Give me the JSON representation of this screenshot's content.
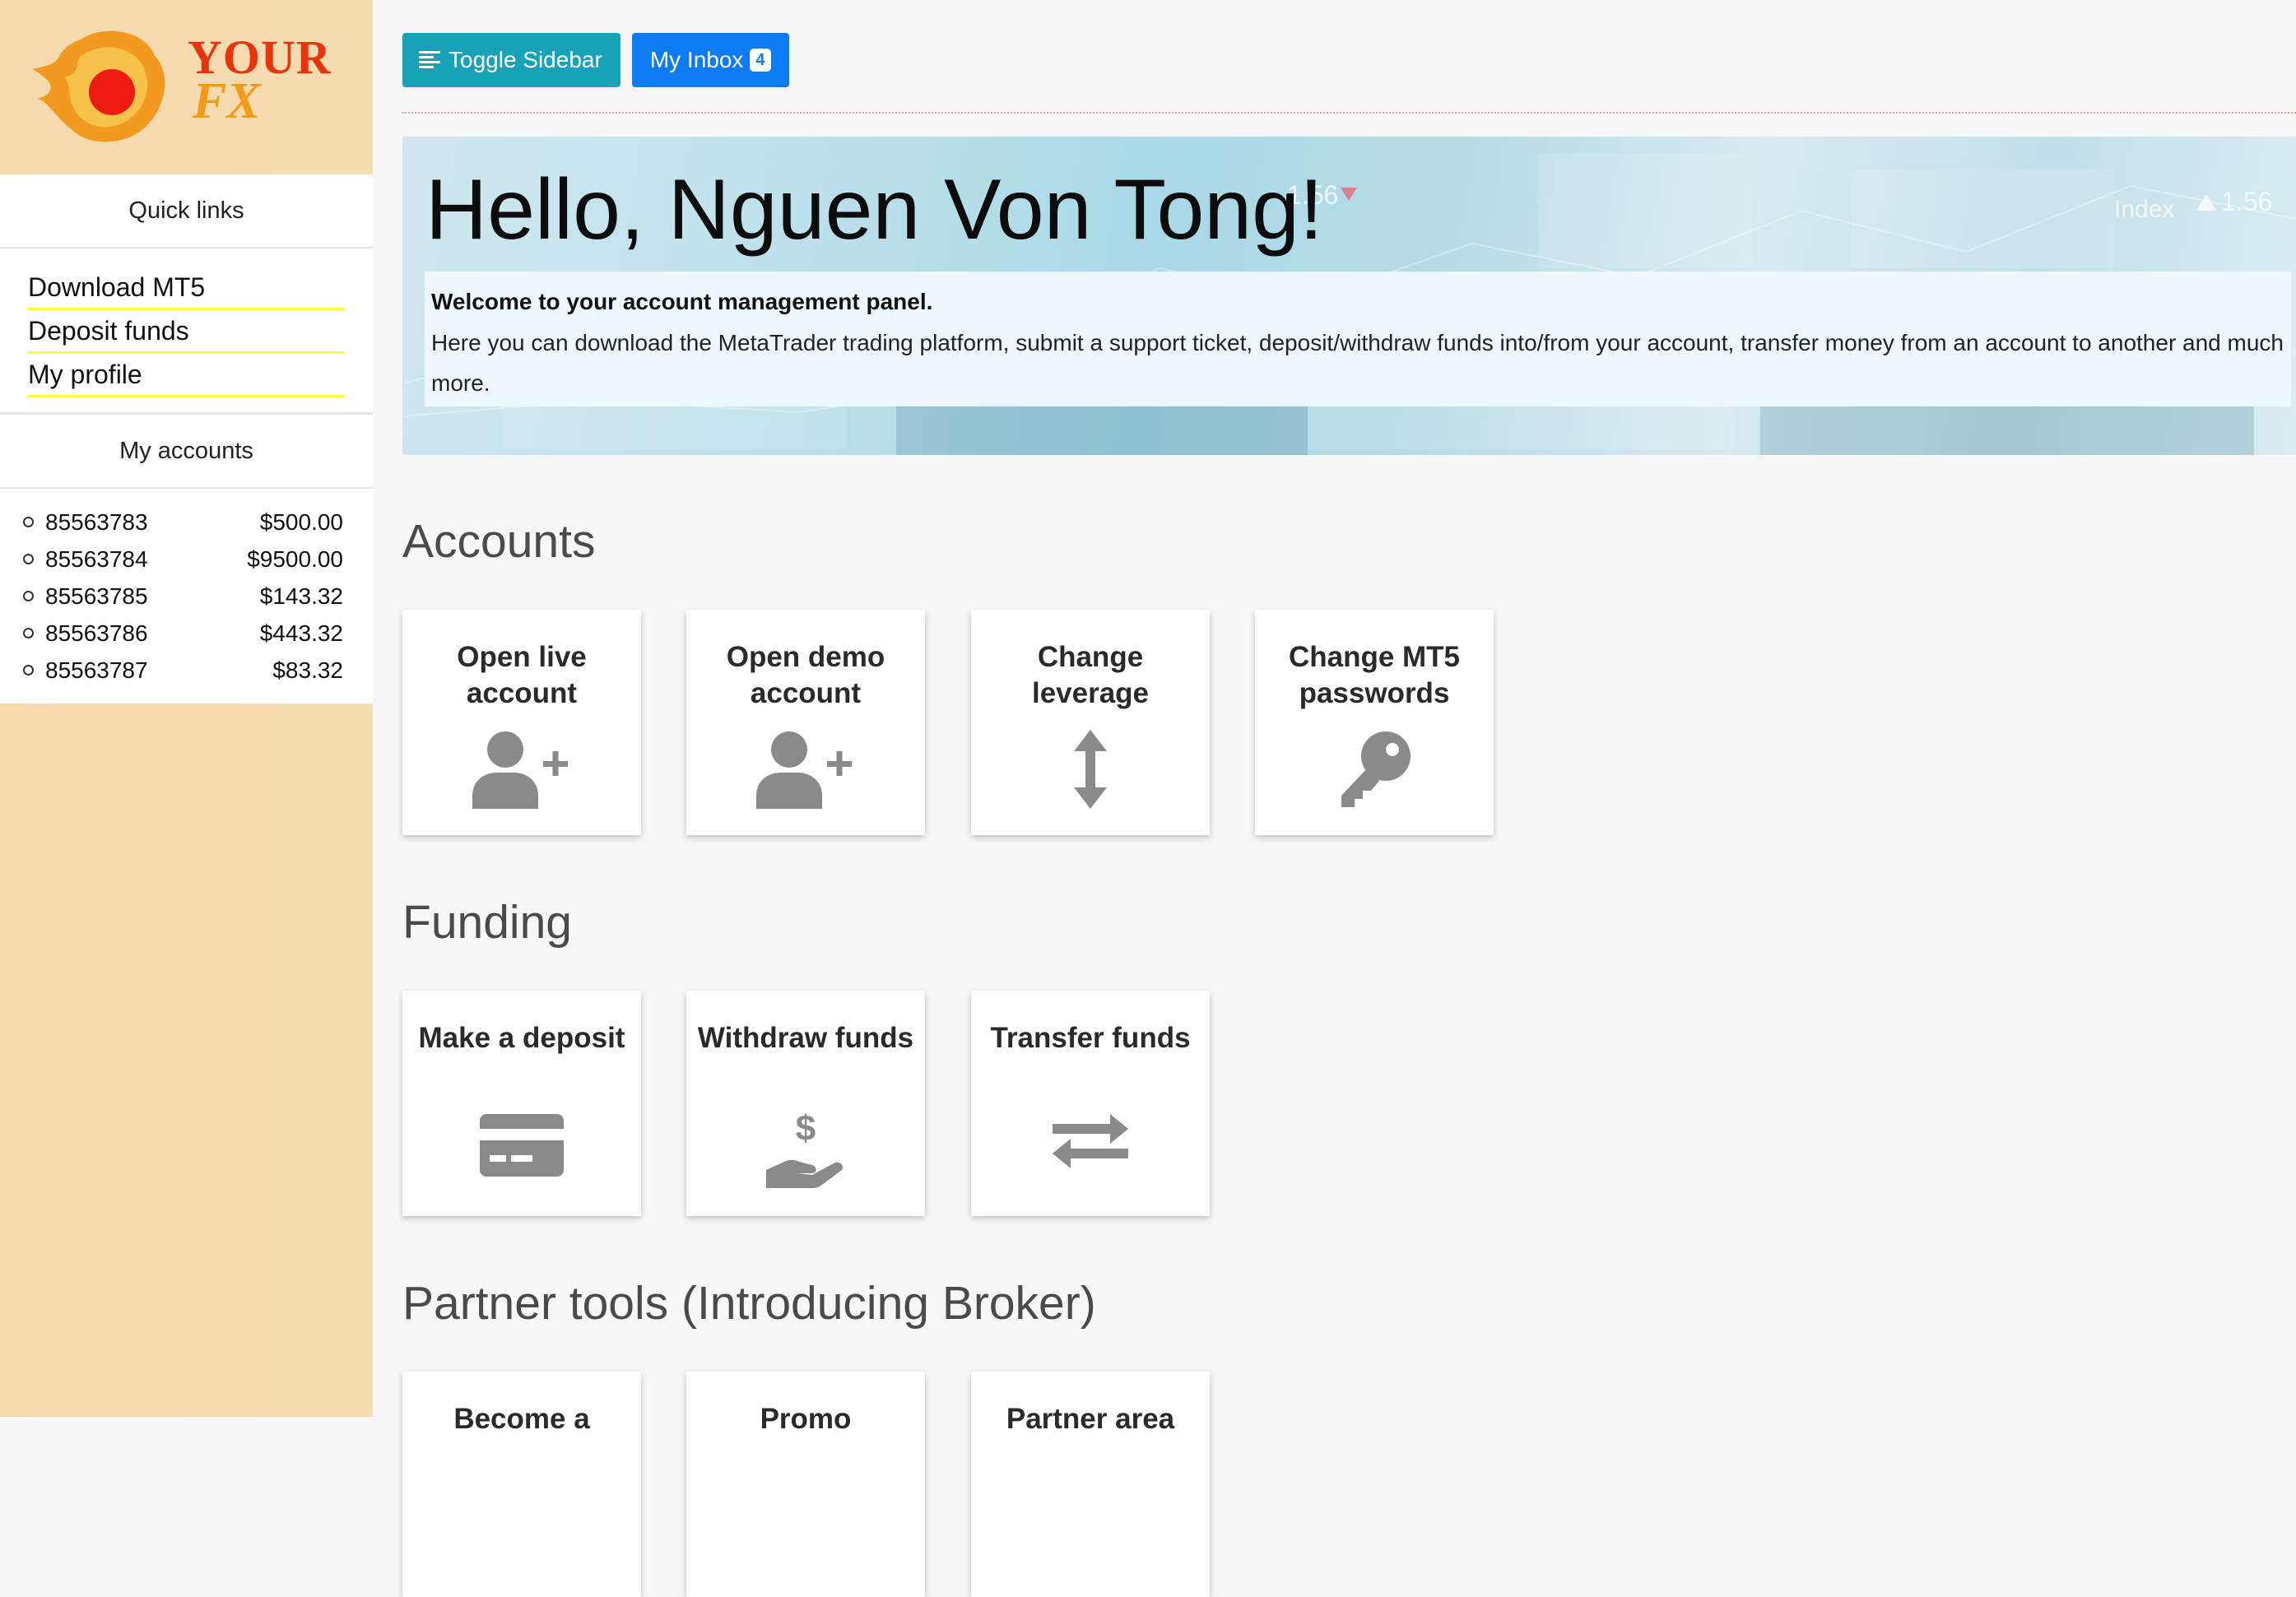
{
  "brand": {
    "word1": "YOUR",
    "word2": "FX"
  },
  "sidebar": {
    "quick_links_title": "Quick links",
    "quick_links": [
      "Download MT5",
      "Deposit funds",
      "My profile"
    ],
    "accounts_title": "My accounts",
    "accounts": [
      {
        "number": "85563783",
        "balance": "$500.00"
      },
      {
        "number": "85563784",
        "balance": "$9500.00"
      },
      {
        "number": "85563785",
        "balance": "$143.32"
      },
      {
        "number": "85563786",
        "balance": "$443.32"
      },
      {
        "number": "85563787",
        "balance": "$83.32"
      }
    ]
  },
  "toolbar": {
    "toggle_label": "Toggle Sidebar",
    "inbox_label": "My Inbox",
    "inbox_count": "4"
  },
  "hero": {
    "greeting": "Hello, Nguen Von Tong!",
    "welcome": "Welcome to your account management panel.",
    "description": "Here you can download the MetaTrader trading platform, submit a support ticket, deposit/withdraw funds into/from your account, transfer money from an account to another and much more.",
    "bg_text_1": "1.56",
    "bg_text_2": "Index",
    "bg_text_3": "1.56"
  },
  "sections": {
    "accounts": {
      "title": "Accounts",
      "cards": [
        {
          "label": "Open live account",
          "icon": "user-plus-icon"
        },
        {
          "label": "Open demo account",
          "icon": "user-plus-icon"
        },
        {
          "label": "Change leverage",
          "icon": "arrows-vertical-icon"
        },
        {
          "label": "Change MT5 passwords",
          "icon": "key-icon"
        }
      ]
    },
    "funding": {
      "title": "Funding",
      "cards": [
        {
          "label": "Make a deposit",
          "icon": "credit-card-icon"
        },
        {
          "label": "Withdraw funds",
          "icon": "hand-dollar-icon"
        },
        {
          "label": "Transfer funds",
          "icon": "exchange-arrows-icon"
        }
      ]
    },
    "partner": {
      "title": "Partner tools (Introducing Broker)",
      "cards": [
        {
          "label": "Become a"
        },
        {
          "label": "Promo"
        },
        {
          "label": "Partner area"
        }
      ]
    }
  },
  "colors": {
    "sidebar_bg": "#f4d9ab",
    "toggle_button": "#17a2b8",
    "inbox_button": "#0d7cf2",
    "link_underline": "#ffff3d",
    "icon_gray": "#8a8a8a"
  }
}
